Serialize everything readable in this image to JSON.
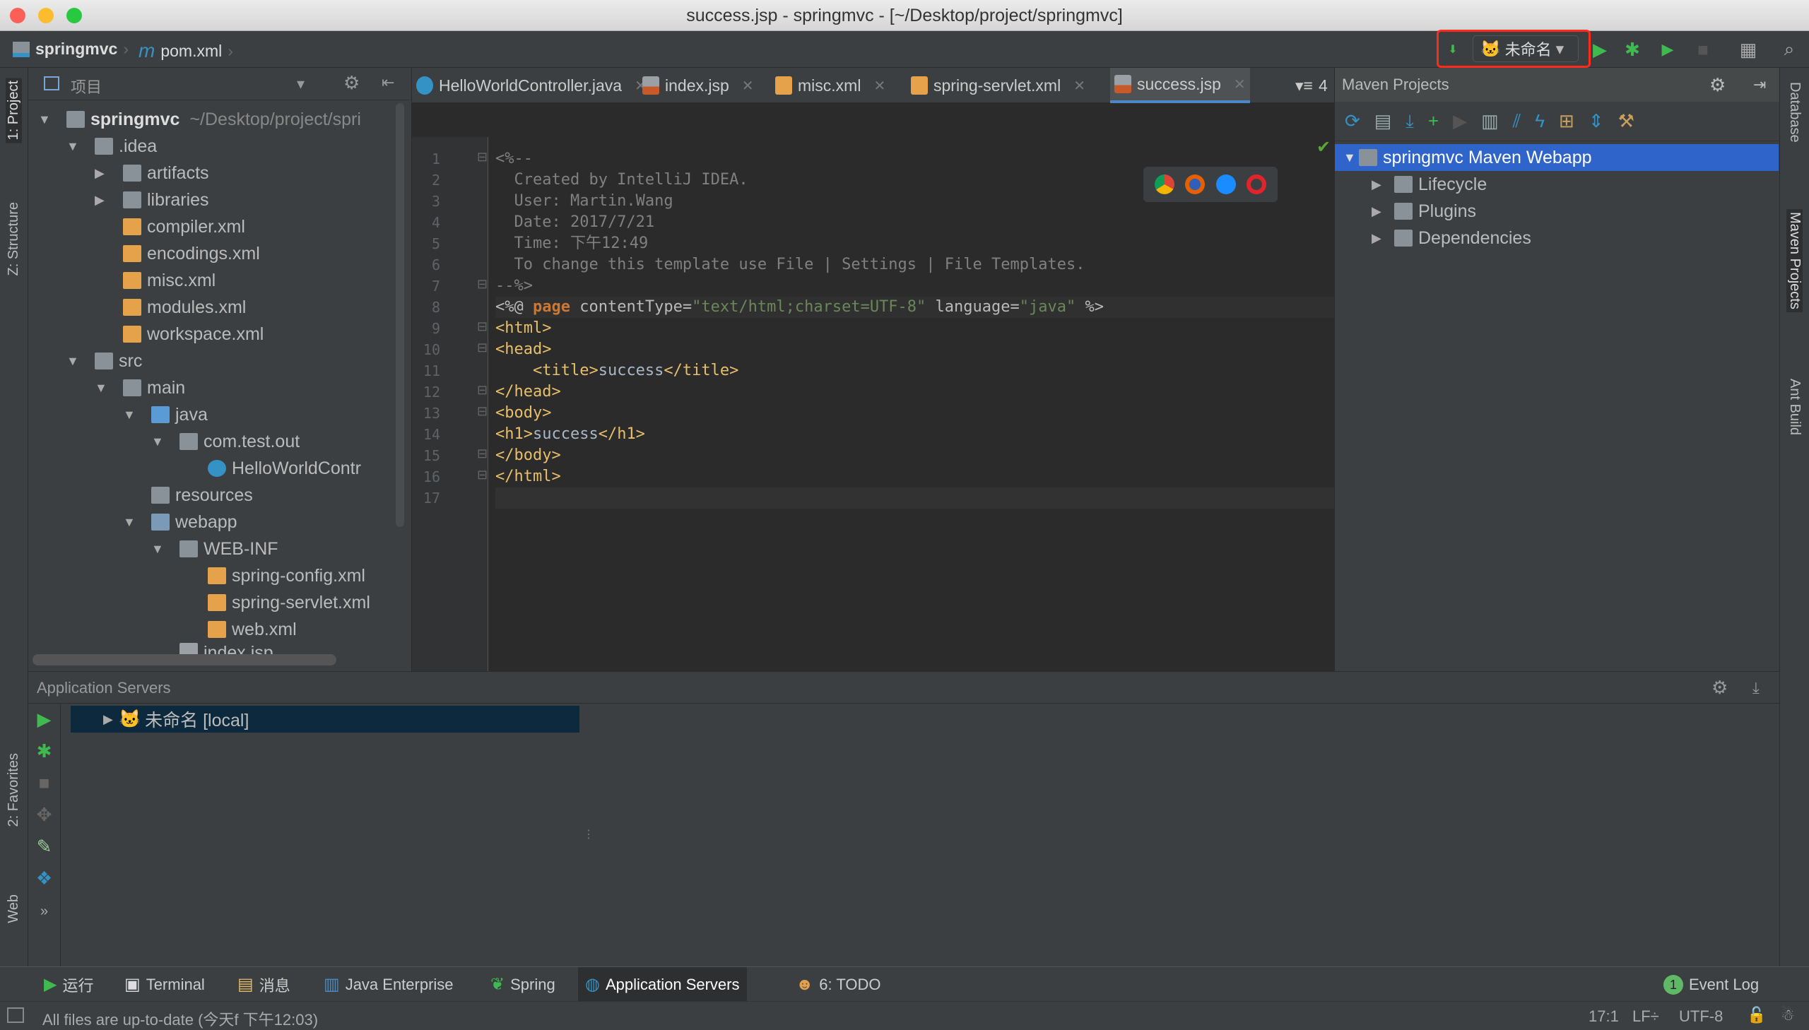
{
  "window": {
    "title": "success.jsp - springmvc - [~/Desktop/project/springmvc]"
  },
  "nav": {
    "crumbs": [
      "springmvc",
      "pom.xml"
    ],
    "run_config": "未命名",
    "run_config_highlight": "#ff2a1a"
  },
  "left_strip": [
    "1: Project",
    "Z: Structure",
    "2: Favorites",
    "Web"
  ],
  "right_strip": [
    "Database",
    "Maven Projects",
    "Ant Build"
  ],
  "project": {
    "title": "项目",
    "tree": [
      {
        "level": 0,
        "arrow": "open",
        "icon": "folder",
        "label": "springmvc",
        "hint": "~/Desktop/project/spri",
        "bold": true
      },
      {
        "level": 1,
        "arrow": "open",
        "icon": "folder",
        "label": ".idea"
      },
      {
        "level": 2,
        "arrow": "closed",
        "icon": "folder",
        "label": "artifacts"
      },
      {
        "level": 2,
        "arrow": "closed",
        "icon": "folder",
        "label": "libraries"
      },
      {
        "level": 2,
        "arrow": "none",
        "icon": "xml",
        "label": "compiler.xml"
      },
      {
        "level": 2,
        "arrow": "none",
        "icon": "xml",
        "label": "encodings.xml"
      },
      {
        "level": 2,
        "arrow": "none",
        "icon": "xml",
        "label": "misc.xml"
      },
      {
        "level": 2,
        "arrow": "none",
        "icon": "xml",
        "label": "modules.xml"
      },
      {
        "level": 2,
        "arrow": "none",
        "icon": "xml",
        "label": "workspace.xml"
      },
      {
        "level": 1,
        "arrow": "open",
        "icon": "folder",
        "label": "src"
      },
      {
        "level": 2,
        "arrow": "open",
        "icon": "folder",
        "label": "main"
      },
      {
        "level": 3,
        "arrow": "open",
        "icon": "folder-blue",
        "label": "java"
      },
      {
        "level": 4,
        "arrow": "open",
        "icon": "package",
        "label": "com.test.out"
      },
      {
        "level": 5,
        "arrow": "none",
        "icon": "class",
        "label": "HelloWorldContr"
      },
      {
        "level": 3,
        "arrow": "none",
        "icon": "folder",
        "label": "resources"
      },
      {
        "level": 3,
        "arrow": "open",
        "icon": "folder-web",
        "label": "webapp"
      },
      {
        "level": 4,
        "arrow": "open",
        "icon": "folder",
        "label": "WEB-INF"
      },
      {
        "level": 5,
        "arrow": "none",
        "icon": "spring-xml",
        "label": "spring-config.xml"
      },
      {
        "level": 5,
        "arrow": "none",
        "icon": "spring-xml",
        "label": "spring-servlet.xml"
      },
      {
        "level": 5,
        "arrow": "none",
        "icon": "web-xml",
        "label": "web.xml"
      },
      {
        "level": 4,
        "arrow": "none",
        "icon": "jsp",
        "label": "index.jsp"
      }
    ]
  },
  "editor": {
    "tabs": [
      {
        "label": "HelloWorldController.java",
        "icon": "class"
      },
      {
        "label": "index.jsp",
        "icon": "jsp"
      },
      {
        "label": "misc.xml",
        "icon": "xml"
      },
      {
        "label": "spring-servlet.xml",
        "icon": "spring-xml"
      },
      {
        "label": "success.jsp",
        "icon": "jsp",
        "active": true
      }
    ],
    "overflow": "4",
    "lines": [
      [
        [
          "comment",
          "<%--"
        ]
      ],
      [
        [
          "comment",
          "  Created by IntelliJ IDEA."
        ]
      ],
      [
        [
          "comment",
          "  User: Martin.Wang"
        ]
      ],
      [
        [
          "comment",
          "  Date: 2017/7/21"
        ]
      ],
      [
        [
          "comment",
          "  Time: 下午12:49"
        ]
      ],
      [
        [
          "comment",
          "  To change this template use File | Settings | File Templates."
        ]
      ],
      [
        [
          "comment",
          "--%>"
        ]
      ],
      [
        [
          "attr",
          "<%@ "
        ],
        [
          "kw",
          "page"
        ],
        [
          "attr",
          " contentType="
        ],
        [
          "str",
          "\"text/html;charset=UTF-8\""
        ],
        [
          "attr",
          " language="
        ],
        [
          "str",
          "\"java\""
        ],
        [
          "attr",
          " %>"
        ]
      ],
      [
        [
          "tag",
          "<html>"
        ]
      ],
      [
        [
          "tag",
          "<head>"
        ]
      ],
      [
        [
          "text",
          "    "
        ],
        [
          "tag",
          "<title>"
        ],
        [
          "text",
          "success"
        ],
        [
          "tag",
          "</title>"
        ]
      ],
      [
        [
          "tag",
          "</head>"
        ]
      ],
      [
        [
          "tag",
          "<body>"
        ]
      ],
      [
        [
          "tag",
          "<h1>"
        ],
        [
          "text",
          "success"
        ],
        [
          "tag",
          "</h1>"
        ]
      ],
      [
        [
          "tag",
          "</body>"
        ]
      ],
      [
        [
          "tag",
          "</html>"
        ]
      ],
      []
    ]
  },
  "maven": {
    "title": "Maven Projects",
    "root": "springmvc Maven Webapp",
    "children": [
      "Lifecycle",
      "Plugins",
      "Dependencies"
    ]
  },
  "app_servers": {
    "title": "Application Servers",
    "server": "未命名 [local]"
  },
  "tool_windows": [
    {
      "label": "运行",
      "icon": "run"
    },
    {
      "label": "Terminal",
      "icon": "terminal"
    },
    {
      "label": "消息",
      "icon": "messages"
    },
    {
      "label": "Java Enterprise",
      "icon": "java-enterprise"
    },
    {
      "label": "Spring",
      "icon": "spring"
    },
    {
      "label": "Application Servers",
      "icon": "app-servers",
      "active": true
    },
    {
      "label": "6: TODO",
      "icon": "todo"
    }
  ],
  "event_log": {
    "label": "Event Log",
    "count": "1"
  },
  "status": {
    "message": "All files are up-to-date (今天f 下午12:03)",
    "position": "17:1",
    "line_sep": "LF÷",
    "encoding": "UTF-8"
  }
}
